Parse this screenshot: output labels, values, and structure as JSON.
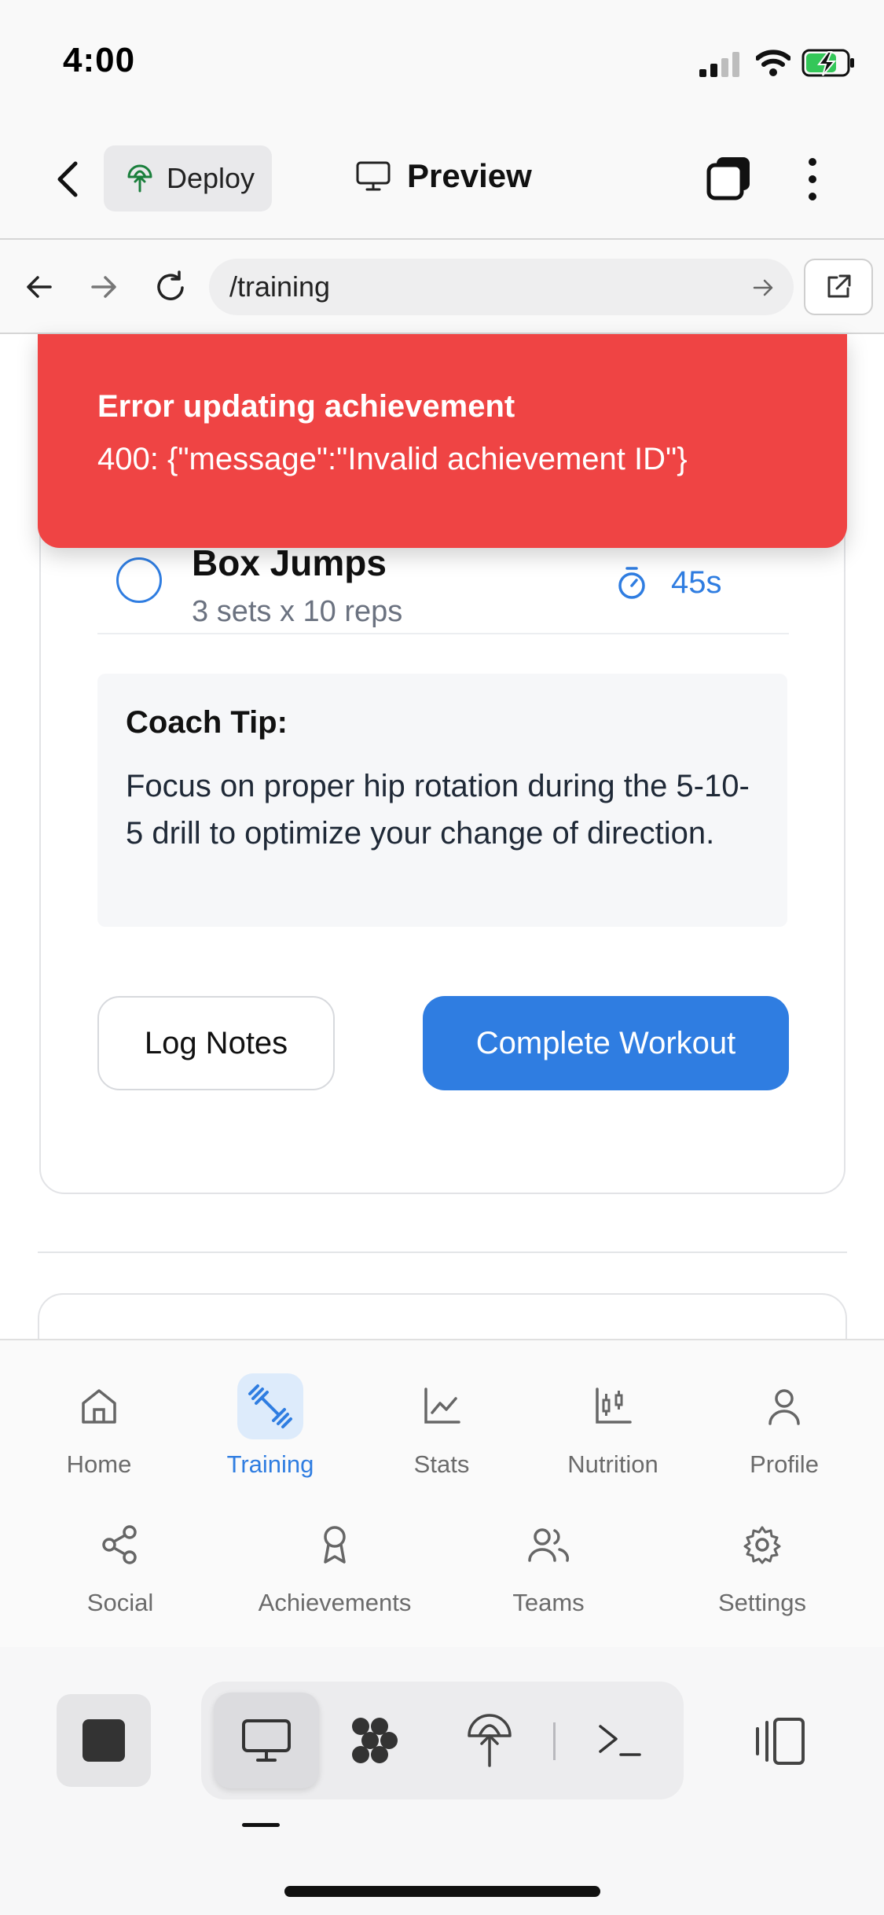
{
  "status_bar": {
    "time": "4:00"
  },
  "app_bar": {
    "deploy_label": "Deploy",
    "preview_label": "Preview"
  },
  "url_bar": {
    "url": "/training"
  },
  "toast": {
    "title": "Error updating achievement",
    "message": "400: {\"message\":\"Invalid achievement ID\"}",
    "color": "#ef4444"
  },
  "exercise": {
    "name": "Box Jumps",
    "detail": "3 sets x 10 reps",
    "rest": "45s"
  },
  "coach_tip": {
    "title": "Coach Tip:",
    "text": "Focus on proper hip rotation during the 5-10-5 drill to optimize your change of direction."
  },
  "actions": {
    "log_notes": "Log Notes",
    "complete_workout": "Complete Workout",
    "accent": "#2f7de1"
  },
  "bottom_nav": {
    "row1": [
      {
        "label": "Home",
        "icon": "home-icon"
      },
      {
        "label": "Training",
        "icon": "dumbbell-icon",
        "active": true
      },
      {
        "label": "Stats",
        "icon": "chart-line-icon"
      },
      {
        "label": "Nutrition",
        "icon": "chart-candlestick-icon"
      },
      {
        "label": "Profile",
        "icon": "user-icon"
      }
    ],
    "row2": [
      {
        "label": "Social",
        "icon": "share-icon"
      },
      {
        "label": "Achievements",
        "icon": "award-icon"
      },
      {
        "label": "Teams",
        "icon": "users-icon"
      },
      {
        "label": "Settings",
        "icon": "gear-icon"
      }
    ]
  }
}
